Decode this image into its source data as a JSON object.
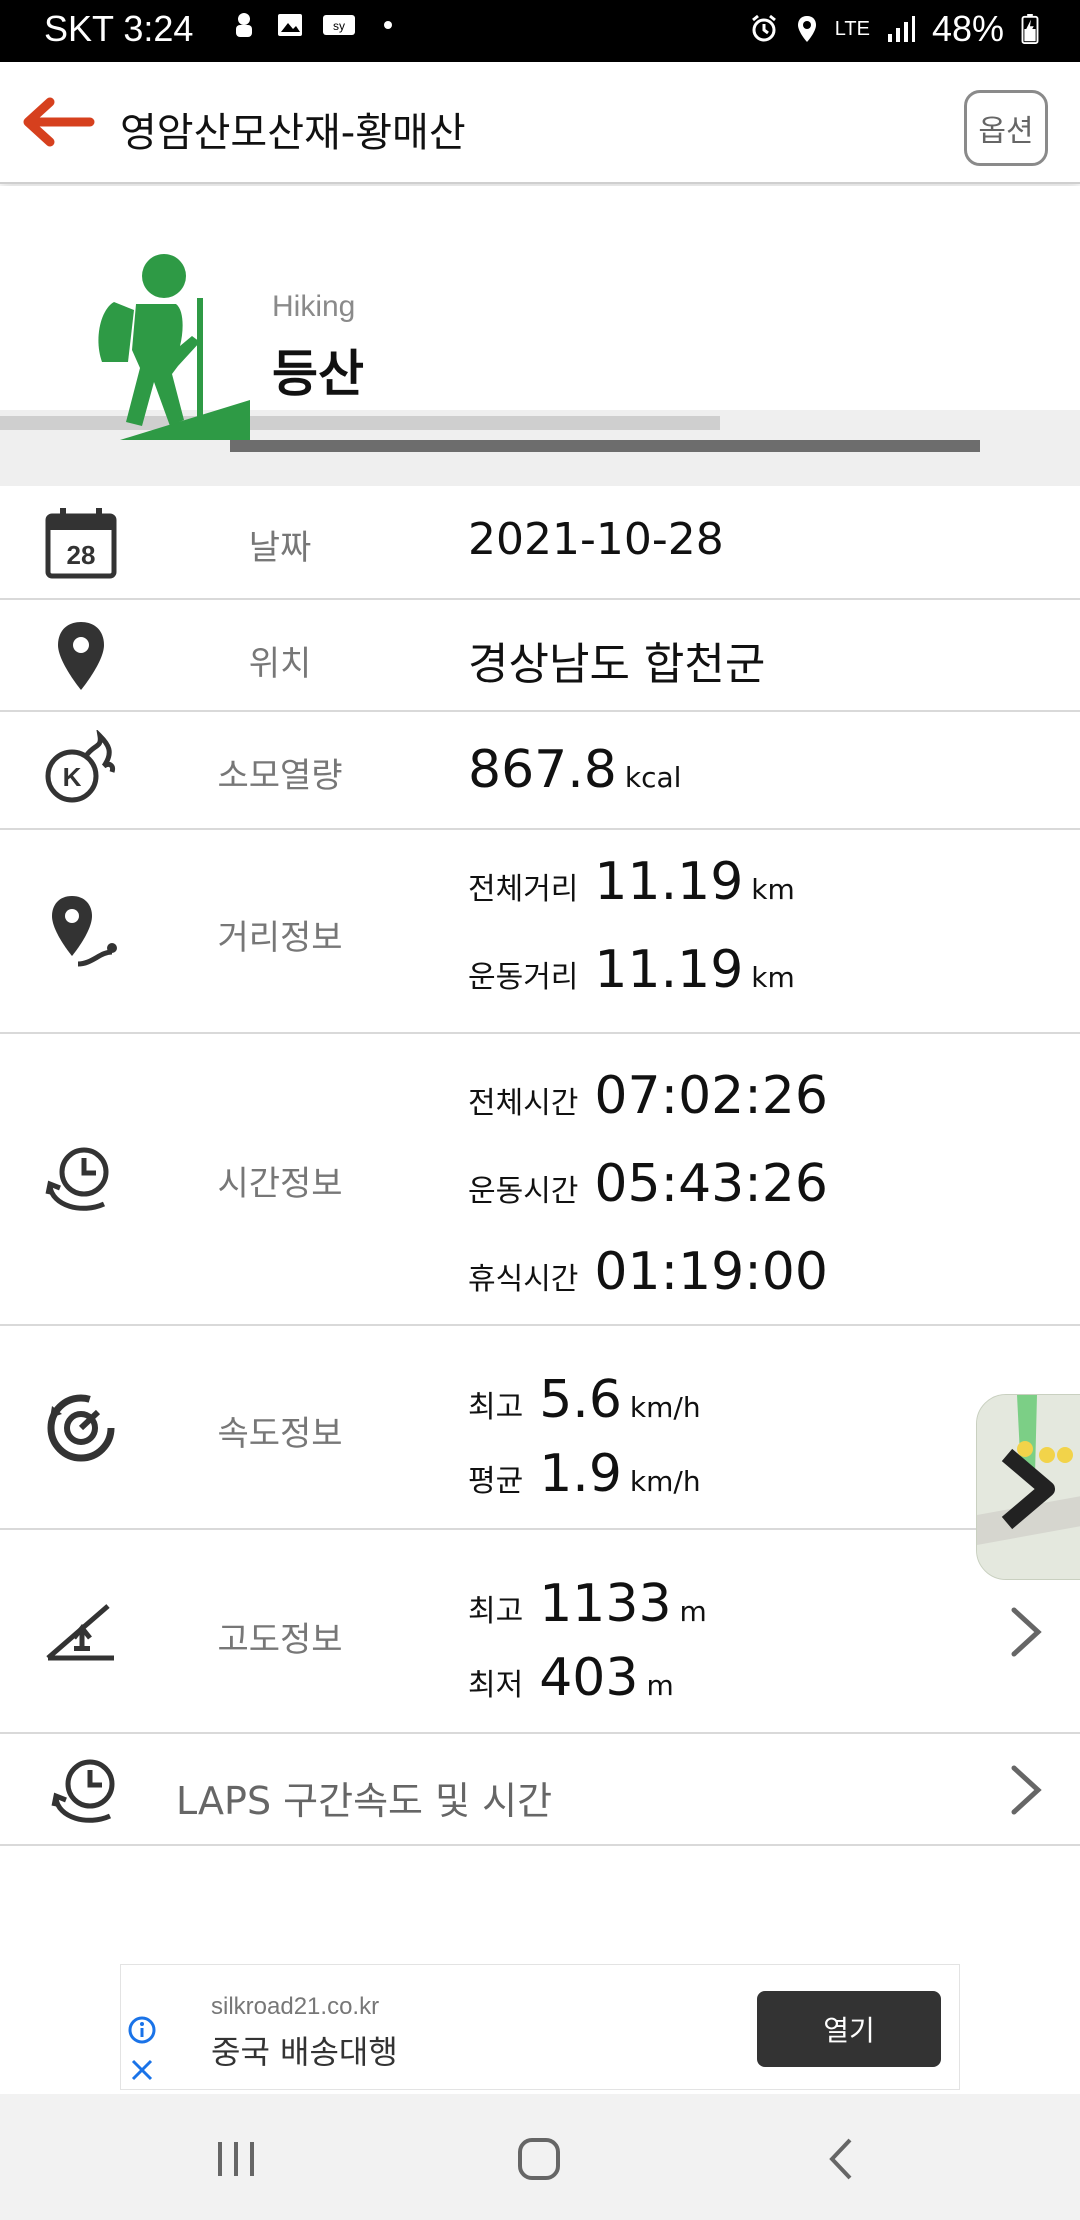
{
  "status_bar": {
    "carrier_time": "SKT 3:24",
    "network": "LTE",
    "battery": "48%"
  },
  "app_bar": {
    "title": "영암산모산재-황매산",
    "option_label": "옵션"
  },
  "activity": {
    "sub_label": "Hiking",
    "name": "등산",
    "accent_color": "#2e9a45"
  },
  "rows": {
    "date": {
      "label": "날짜",
      "value": "2021-10-28"
    },
    "location": {
      "label": "위치",
      "value": "경상남도 합천군"
    },
    "calories": {
      "label": "소모열량",
      "value": "867.8",
      "unit": "kcal"
    },
    "distance": {
      "label": "거리정보",
      "total_label": "전체거리",
      "total_value": "11.19",
      "total_unit": "km",
      "move_label": "운동거리",
      "move_value": "11.19",
      "move_unit": "km"
    },
    "time": {
      "label": "시간정보",
      "total_label": "전체시간",
      "total_value": "07:02:26",
      "move_label": "운동시간",
      "move_value": "05:43:26",
      "rest_label": "휴식시간",
      "rest_value": "01:19:00"
    },
    "speed": {
      "label": "속도정보",
      "max_label": "최고",
      "max_value": "5.6",
      "max_unit": "km/h",
      "avg_label": "평균",
      "avg_value": "1.9",
      "avg_unit": "km/h"
    },
    "altitude": {
      "label": "고도정보",
      "max_label": "최고",
      "max_value": "1133",
      "max_unit": "m",
      "min_label": "최저",
      "min_value": "403",
      "min_unit": "m"
    },
    "laps": {
      "label": "LAPS 구간속도 및 시간"
    }
  },
  "ad": {
    "domain": "silkroad21.co.kr",
    "headline": "중국 배송대행",
    "open_label": "열기"
  }
}
